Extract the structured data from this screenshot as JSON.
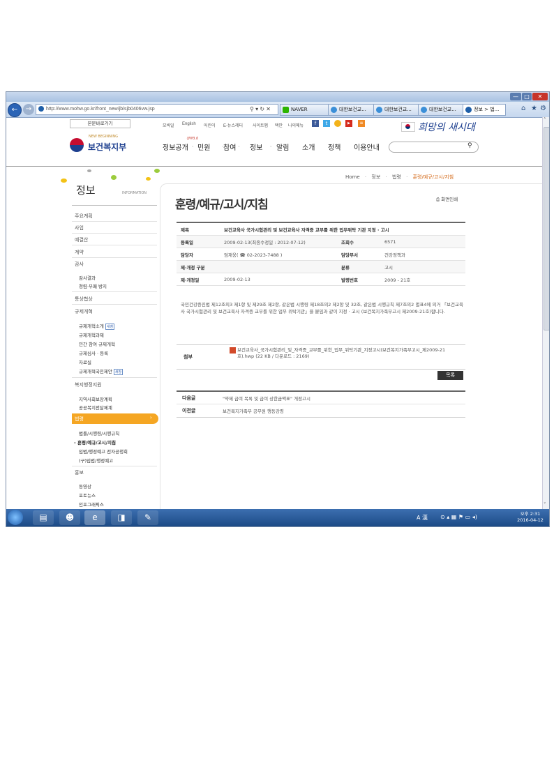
{
  "browser": {
    "url": "http://www.mohw.go.kr/front_new/jb/sjb0406vw.jsp",
    "tabs": [
      "NAVER",
      "대한보건교...",
      "대한보건교...",
      "대한보건교...",
      "정보 > 법..."
    ],
    "window_controls": [
      "—",
      "□",
      "✕"
    ]
  },
  "header": {
    "skip_link": "본문바로가기",
    "util_links": [
      "모바일",
      "English",
      "어린이",
      "E-뉴스레터",
      "사이트맵",
      "택안",
      "나의메뉴"
    ],
    "slogan": "희망의 새시대",
    "logo_sub": "NEW BEGINNING",
    "logo_name": "보건복지부",
    "gnb_badge": "정부3.0",
    "gnb": [
      "정보공개",
      "민원",
      "참여",
      "정보",
      "알림",
      "소개",
      "정책",
      "이용안내"
    ]
  },
  "breadcrumb": [
    "Home",
    "정보",
    "법령",
    "훈령/예규/고시/지침"
  ],
  "lnb": {
    "title": "정보",
    "title_en": "INFORMATION",
    "items": [
      {
        "label": "주요계획"
      },
      {
        "label": "사업"
      },
      {
        "label": "예결산"
      },
      {
        "label": "계약"
      },
      {
        "label": "감사",
        "sub": [
          "감사결과",
          "청렴·부패 방지"
        ]
      },
      {
        "label": "통상협상"
      },
      {
        "label": "규제개혁",
        "sub": [
          "규제개혁소개",
          "규제개혁과제",
          "민간 참여 규제개혁",
          "규제심사 · 등록",
          "자료실",
          "규제개혁국민제안"
        ]
      },
      {
        "label": "복지행정지원",
        "sub": [
          "지역사회보장계획",
          "공공복지전달체계"
        ]
      },
      {
        "label": "법령",
        "sub": [
          "법률/시행령/시행규칙",
          "훈령/예규/고시/지침",
          "입법/행정예고 전자공청회",
          "(구)입법/행정예고"
        ]
      },
      {
        "label": "홍보",
        "sub": [
          "동영상",
          "포토뉴스",
          "인포그래픽스"
        ]
      }
    ],
    "new_badge": "새창"
  },
  "page": {
    "title": "훈령/예규/고시/지침",
    "print_label": "화면인쇄",
    "fields": {
      "subject_label": "제목",
      "subject": "보건교육사 국가시험관리 및 보건교육사 자격증 교부를 위한 업무위탁 기관 지정 · 고시",
      "reg_label": "등록일",
      "reg_value": "2009-02-13(최종수정일 : 2012-07-12)",
      "views_label": "조회수",
      "views_value": "6571",
      "manager_label": "담당자",
      "manager_value": "엄재웅( ☎ 02-2023-7488 )",
      "dept_label": "담당부서",
      "dept_value": "건강정책과",
      "type_label": "제·개정 구분",
      "type_value": "",
      "category_label": "분류",
      "category_value": "고시",
      "date_label": "제·개정일",
      "date_value": "2009-02-13",
      "number_label": "발령번호",
      "number_value": "2009 - 21호"
    },
    "body": "국민건강증진법 제12조의3 제1항 및 제29조 제2항, 같은법 시행령 제18조의2 제2항 및 32조, 같은법 시행규칙 제7조의2 별표4에 의거 「보건교육사 국가시험관리 및 보건교육사 자격증 교부를 위한 업무 위탁기관」을 붙임과 같이 지정 · 고시 (보건복지가족부고시 제2009-21호)합니다.",
    "attach_label": "첨부",
    "attach_value": "보건교육사_국가시험관리_및_자격증_교부를_위한_업무_위탁기관_지정고시(보건복지가족부고시_제2009-21호).hwp (22 KB / 다운로드 : 2169)",
    "list_button": "목록",
    "next_label": "다음글",
    "next_value": "\"약제 급여 목록 및 급여 상한금액표\" 개정고시",
    "prev_label": "이전글",
    "prev_value": "보건복지가족부 공무원 행동강령"
  },
  "taskbar": {
    "time": "오후 2:31",
    "date": "2016-04-12",
    "ime": "A 漢"
  }
}
